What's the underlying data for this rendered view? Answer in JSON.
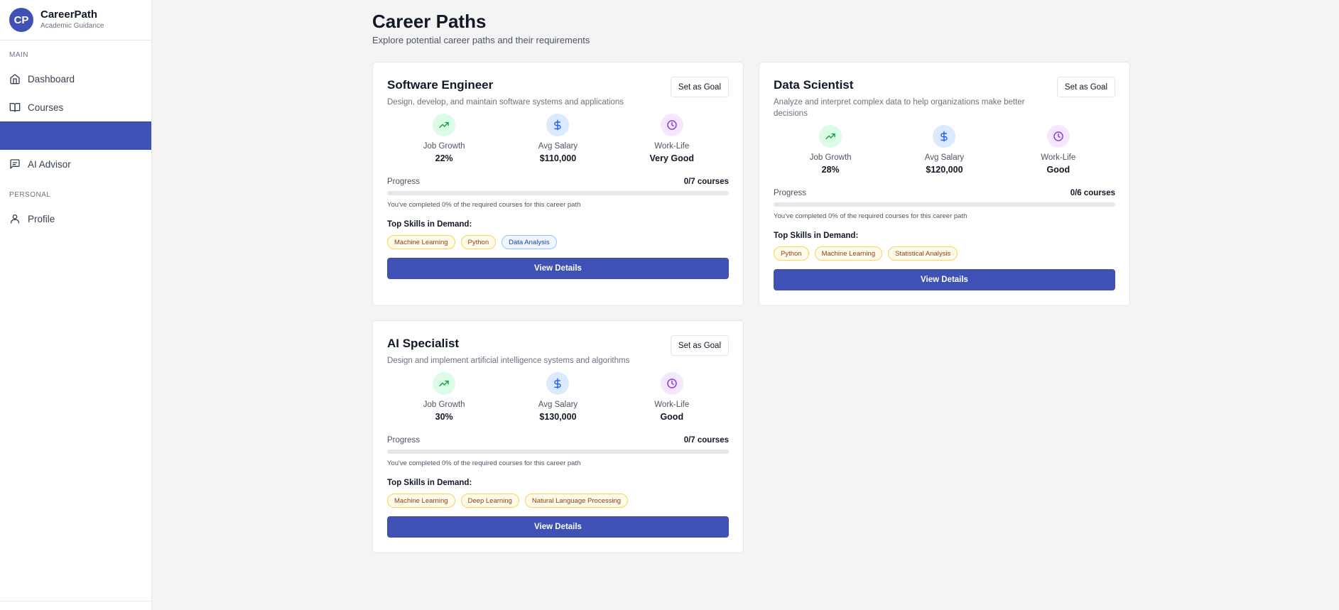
{
  "brand": {
    "logo": "CP",
    "name": "CareerPath",
    "subtitle": "Academic Guidance"
  },
  "sidebar": {
    "section_main": "MAIN",
    "section_personal": "PERSONAL",
    "items": [
      {
        "label": "Dashboard",
        "icon": "home-icon"
      },
      {
        "label": "Courses",
        "icon": "book-icon"
      },
      {
        "label": "",
        "icon": "",
        "active": true
      },
      {
        "label": "AI Advisor",
        "icon": "message-icon"
      },
      {
        "label": "Profile",
        "icon": "user-icon"
      }
    ]
  },
  "page": {
    "title": "Career Paths",
    "subtitle": "Explore potential career paths and their requirements"
  },
  "colors": {
    "primary": "#3f51b5",
    "growth": "#16a34a",
    "salary": "#2563eb",
    "worklife": "#9333ea"
  },
  "cards": [
    {
      "title": "Software Engineer",
      "description": "Design, develop, and maintain software systems and applications",
      "goal_button": "Set as Goal",
      "stats": [
        {
          "label": "Job Growth",
          "value": "22%",
          "icon": "trending-up-icon"
        },
        {
          "label": "Avg Salary",
          "value": "$110,000",
          "icon": "dollar-icon"
        },
        {
          "label": "Work-Life",
          "value": "Very Good",
          "icon": "clock-icon"
        }
      ],
      "progress_label": "Progress",
      "progress_count": "0/7 courses",
      "progress_fraction": 0,
      "progress_note": "You've completed 0% of the required courses for this career path",
      "skills_title": "Top Skills in Demand:",
      "skills": [
        "Machine Learning",
        "Python",
        "Data Analysis"
      ],
      "details_button": "View Details"
    },
    {
      "title": "Data Scientist",
      "description": "Analyze and interpret complex data to help organizations make better decisions",
      "goal_button": "Set as Goal",
      "stats": [
        {
          "label": "Job Growth",
          "value": "28%",
          "icon": "trending-up-icon"
        },
        {
          "label": "Avg Salary",
          "value": "$120,000",
          "icon": "dollar-icon"
        },
        {
          "label": "Work-Life",
          "value": "Good",
          "icon": "clock-icon"
        }
      ],
      "progress_label": "Progress",
      "progress_count": "0/6 courses",
      "progress_fraction": 0,
      "progress_note": "You've completed 0% of the required courses for this career path",
      "skills_title": "Top Skills in Demand:",
      "skills": [
        "Python",
        "Machine Learning",
        "Statistical Analysis"
      ],
      "details_button": "View Details"
    },
    {
      "title": "AI Specialist",
      "description": "Design and implement artificial intelligence systems and algorithms",
      "goal_button": "Set as Goal",
      "stats": [
        {
          "label": "Job Growth",
          "value": "30%",
          "icon": "trending-up-icon"
        },
        {
          "label": "Avg Salary",
          "value": "$130,000",
          "icon": "dollar-icon"
        },
        {
          "label": "Work-Life",
          "value": "Good",
          "icon": "clock-icon"
        }
      ],
      "progress_label": "Progress",
      "progress_count": "0/7 courses",
      "progress_fraction": 0,
      "progress_note": "You've completed 0% of the required courses for this career path",
      "skills_title": "Top Skills in Demand:",
      "skills": [
        "Machine Learning",
        "Deep Learning",
        "Natural Language Processing"
      ],
      "details_button": "View Details"
    }
  ]
}
